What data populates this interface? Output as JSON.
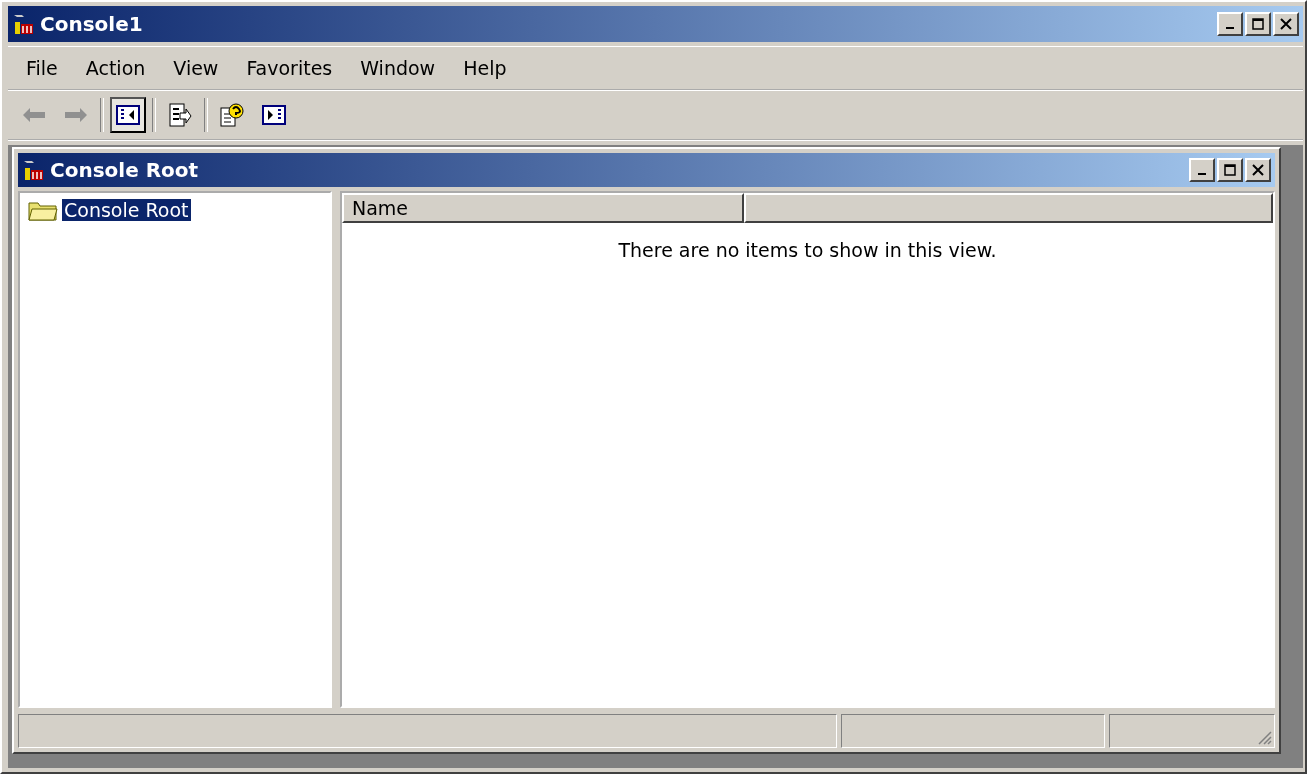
{
  "window": {
    "title": "Console1"
  },
  "menu": [
    "File",
    "Action",
    "View",
    "Favorites",
    "Window",
    "Help"
  ],
  "toolbar": [
    {
      "kind": "back",
      "disabled": true
    },
    {
      "kind": "forward",
      "disabled": true
    },
    {
      "kind": "sep"
    },
    {
      "kind": "tree",
      "selected": true
    },
    {
      "kind": "sep"
    },
    {
      "kind": "export",
      "selected": false
    },
    {
      "kind": "sep"
    },
    {
      "kind": "help",
      "selected": false
    },
    {
      "kind": "action",
      "selected": false
    }
  ],
  "child": {
    "title": "Console Root",
    "tree": [
      {
        "label": "Console Root",
        "selected": true
      }
    ],
    "columns": [
      "Name",
      ""
    ],
    "empty_message": "There are no items to show in this view."
  }
}
